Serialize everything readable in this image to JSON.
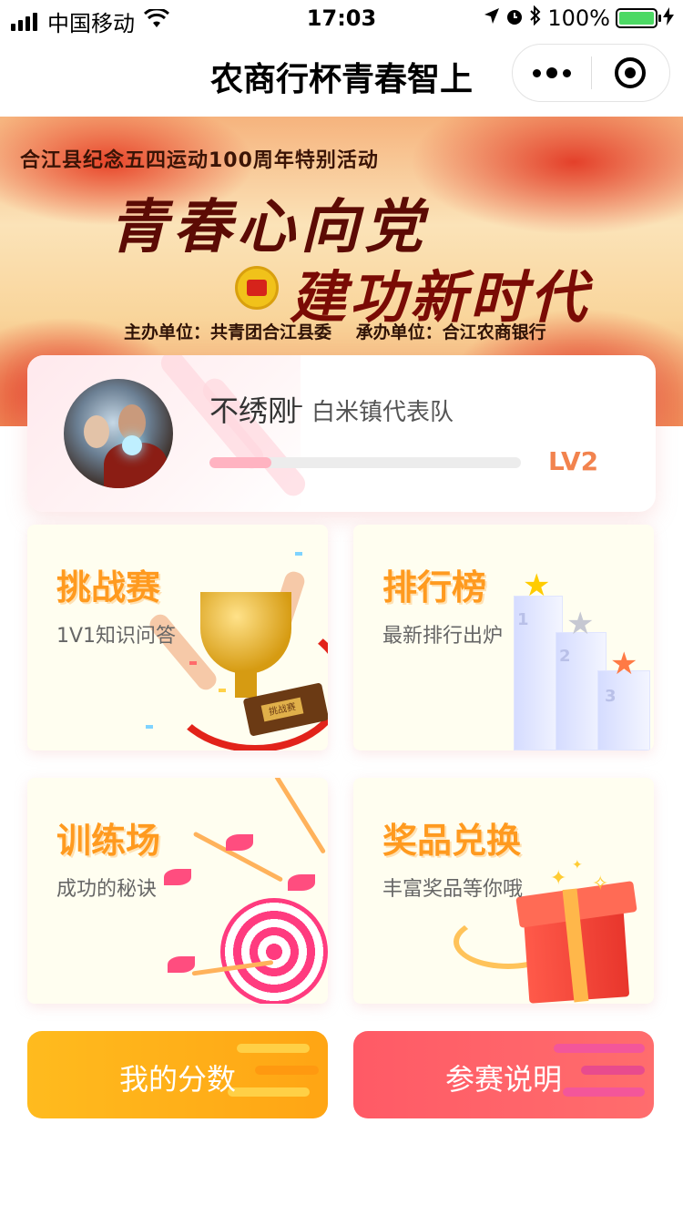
{
  "status_bar": {
    "carrier": "中国移动",
    "time": "17:03",
    "battery": "100%",
    "battery_level": 1.0,
    "icons": [
      "signal-icon",
      "wifi-icon",
      "location-icon",
      "alarm-icon",
      "bluetooth-icon",
      "battery-icon",
      "charging-icon"
    ]
  },
  "nav": {
    "title": "农商行杯青春智上",
    "more_icon": "more-dots-icon",
    "close_icon": "close-miniprogram-icon"
  },
  "banner": {
    "subtitle": "合江县纪念五四运动100周年特别活动",
    "slogan_line1": "青春心向党",
    "slogan_line2": "建功新时代",
    "host": "主办单位：共青团合江县委",
    "organizer": "承办单位：合江农商银行"
  },
  "profile": {
    "name": "不绣刚",
    "separator": "–",
    "team": "白米镇代表队",
    "progress": 0.2,
    "level": "LV2",
    "accent_color": "#f2834e"
  },
  "tiles": {
    "challenge": {
      "title": "挑战赛",
      "subtitle": "1V1知识问答",
      "plaque": "挑战赛"
    },
    "ranking": {
      "title": "排行榜",
      "subtitle": "最新排行出炉",
      "podium": [
        "1",
        "2",
        "3"
      ]
    },
    "training": {
      "title": "训练场",
      "subtitle": "成功的秘诀"
    },
    "prize": {
      "title": "奖品兑换",
      "subtitle": "丰富奖品等你哦"
    }
  },
  "buttons": {
    "score": "我的分数",
    "rules": "参赛说明"
  },
  "colors": {
    "tile_title": "#ff9a1f",
    "score_button": "#ffb01a",
    "rules_button": "#ff5f68"
  }
}
